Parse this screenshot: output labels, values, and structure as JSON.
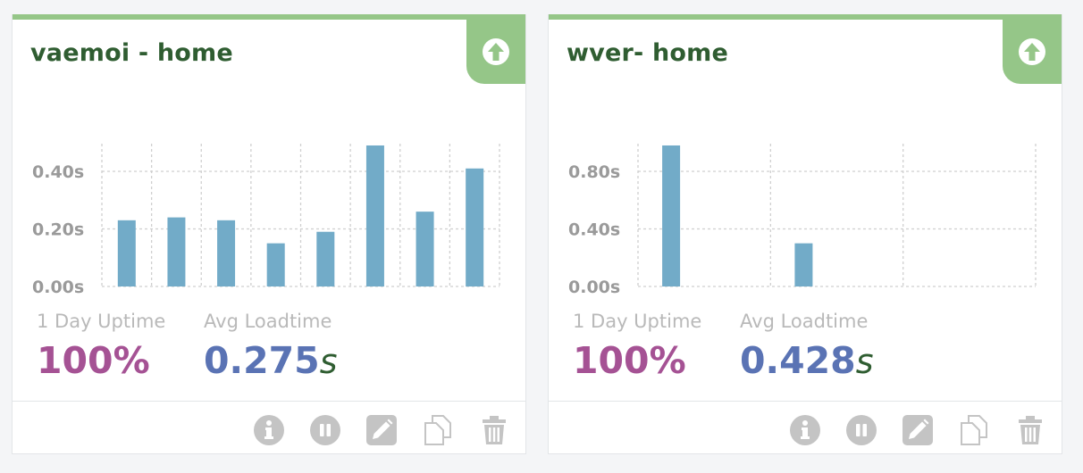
{
  "colors": {
    "status_up": "#95c688",
    "title": "#2f5d31",
    "uptime": "#a55294",
    "loadtime": "#5a73b4",
    "bar": "#72abc8",
    "action_icon": "#c4c4c4"
  },
  "monitors": [
    {
      "title": "vaemoi - home",
      "status_icon": "up-arrow-circle-icon",
      "uptime_label": "1 Day Uptime",
      "uptime_value": "100%",
      "loadtime_label": "Avg Loadtime",
      "loadtime_value": "0.275",
      "loadtime_unit": "s",
      "actions": [
        "info-icon",
        "pause-icon",
        "edit-icon",
        "duplicate-icon",
        "delete-icon"
      ],
      "chart_data": {
        "type": "bar",
        "y_ticks": [
          "0.00s",
          "0.20s",
          "0.40s"
        ],
        "ylim": [
          0,
          0.5
        ],
        "values": [
          0.23,
          0.24,
          0.23,
          0.15,
          0.19,
          0.49,
          0.26,
          0.41
        ],
        "grid": true
      }
    },
    {
      "title": "wver- home",
      "status_icon": "up-arrow-circle-icon",
      "uptime_label": "1 Day Uptime",
      "uptime_value": "100%",
      "loadtime_label": "Avg Loadtime",
      "loadtime_value": "0.428",
      "loadtime_unit": "s",
      "actions": [
        "info-icon",
        "pause-icon",
        "edit-icon",
        "duplicate-icon",
        "delete-icon"
      ],
      "chart_data": {
        "type": "bar",
        "y_ticks": [
          "0.00s",
          "0.40s",
          "0.80s"
        ],
        "ylim": [
          0,
          1.0
        ],
        "values": [
          0.98,
          0.3
        ],
        "grid": true
      }
    }
  ]
}
